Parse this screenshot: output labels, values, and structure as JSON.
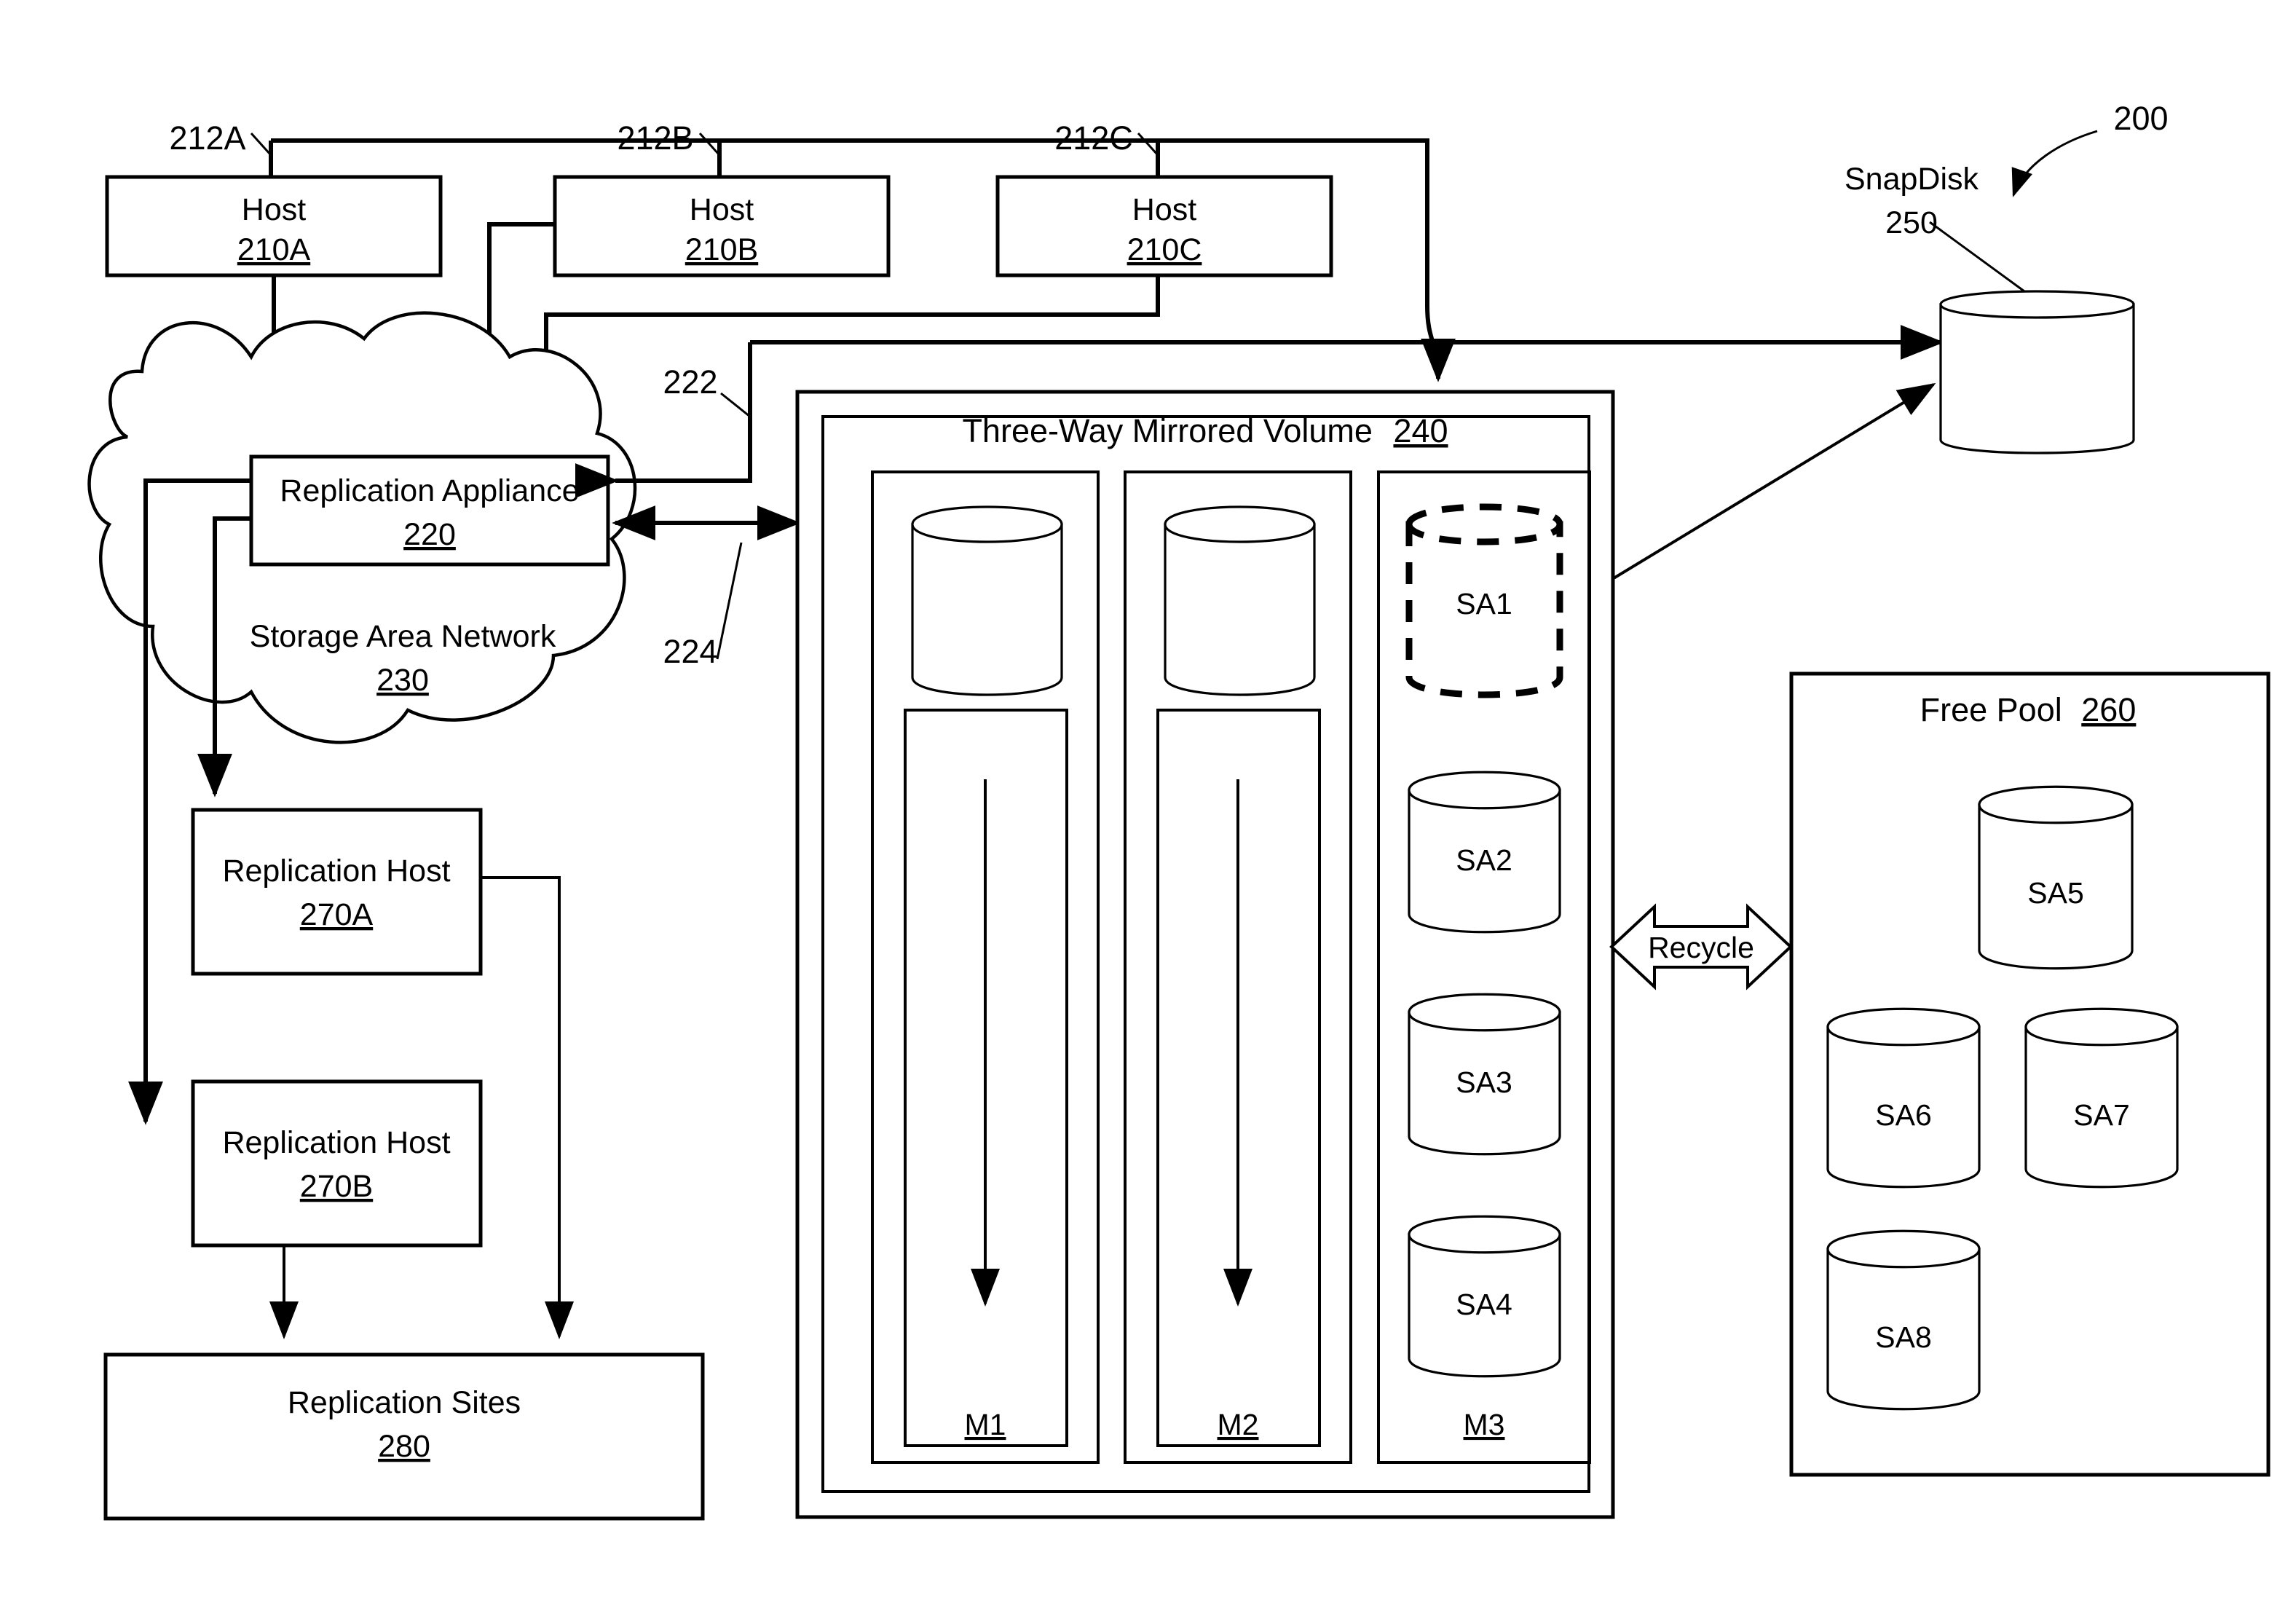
{
  "figure": {
    "reference_numeral": "200",
    "hosts": [
      {
        "label": "Host",
        "number": "210A",
        "link": "212A"
      },
      {
        "label": "Host",
        "number": "210B",
        "link": "212B"
      },
      {
        "label": "Host",
        "number": "210C",
        "link": "212C"
      }
    ],
    "replication_appliance": {
      "label": "Replication Appliance",
      "number": "220"
    },
    "storage_area_network": {
      "label": "Storage Area Network",
      "number": "230"
    },
    "san_links": {
      "upper": "222",
      "lower": "224"
    },
    "replication_hosts": [
      {
        "label": "Replication Host",
        "number": "270A"
      },
      {
        "label": "Replication Host",
        "number": "270B"
      }
    ],
    "replication_sites": {
      "label": "Replication Sites",
      "number": "280"
    },
    "snapdisk": {
      "label": "SnapDisk",
      "number": "250"
    },
    "mirrored_volume": {
      "title": "Three-Way Mirrored Volume",
      "number": "240",
      "mirrors": [
        {
          "name": "M1",
          "kind": "plex-with-arrow",
          "snapshots": []
        },
        {
          "name": "M2",
          "kind": "plex-with-arrow",
          "snapshots": []
        },
        {
          "name": "M3",
          "kind": "snapshot-stack",
          "snapshots": [
            "SA1",
            "SA2",
            "SA3",
            "SA4"
          ]
        }
      ]
    },
    "free_pool": {
      "title": "Free Pool",
      "number": "260",
      "snapshots": [
        "SA5",
        "SA6",
        "SA7",
        "SA8"
      ]
    },
    "recycle": {
      "label": "Recycle"
    }
  },
  "colors": {
    "ink": "#000000",
    "paper": "#ffffff"
  }
}
